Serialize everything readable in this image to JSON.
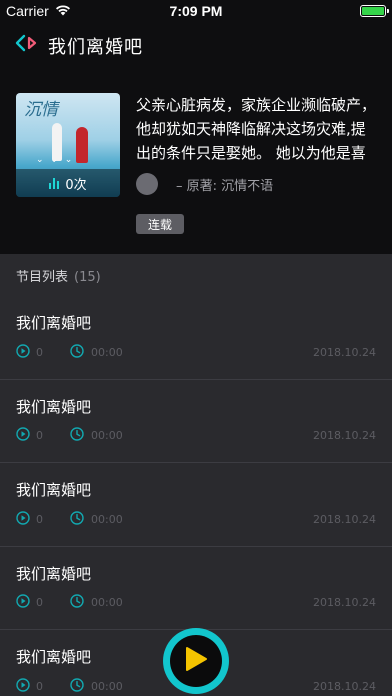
{
  "status_bar": {
    "carrier": "Carrier",
    "time": "7:09 PM",
    "battery_color": "#35d44a"
  },
  "header": {
    "title": "我们离婚吧",
    "back_icon": "back-arrow-icon"
  },
  "album": {
    "cover_title": "沉情",
    "play_count": "0次",
    "synopsis_lines": [
      "父亲心脏病发，家族企业濒临破产，",
      "他却犹如天神降临解决这场灾难,提",
      "出的条件只是娶她。 她以为他是喜"
    ],
    "author_label": "– 原著:  沉情不语",
    "status": "连载"
  },
  "list": {
    "title": "节目列表",
    "count": "(15)"
  },
  "episodes": [
    {
      "title": "我们离婚吧",
      "plays": "0",
      "duration": "00:00",
      "date": "2018.10.24"
    },
    {
      "title": "我们离婚吧",
      "plays": "0",
      "duration": "00:00",
      "date": "2018.10.24"
    },
    {
      "title": "我们离婚吧",
      "plays": "0",
      "duration": "00:00",
      "date": "2018.10.24"
    },
    {
      "title": "我们离婚吧",
      "plays": "0",
      "duration": "00:00",
      "date": "2018.10.24"
    },
    {
      "title": "我们离婚吧",
      "plays": "0",
      "duration": "00:00",
      "date": "2018.10.24"
    }
  ],
  "colors": {
    "accent": "#12c6cd",
    "play_icon": "#f5c400",
    "background": "#2a2a2e",
    "header_bg": "#0e0e10"
  }
}
